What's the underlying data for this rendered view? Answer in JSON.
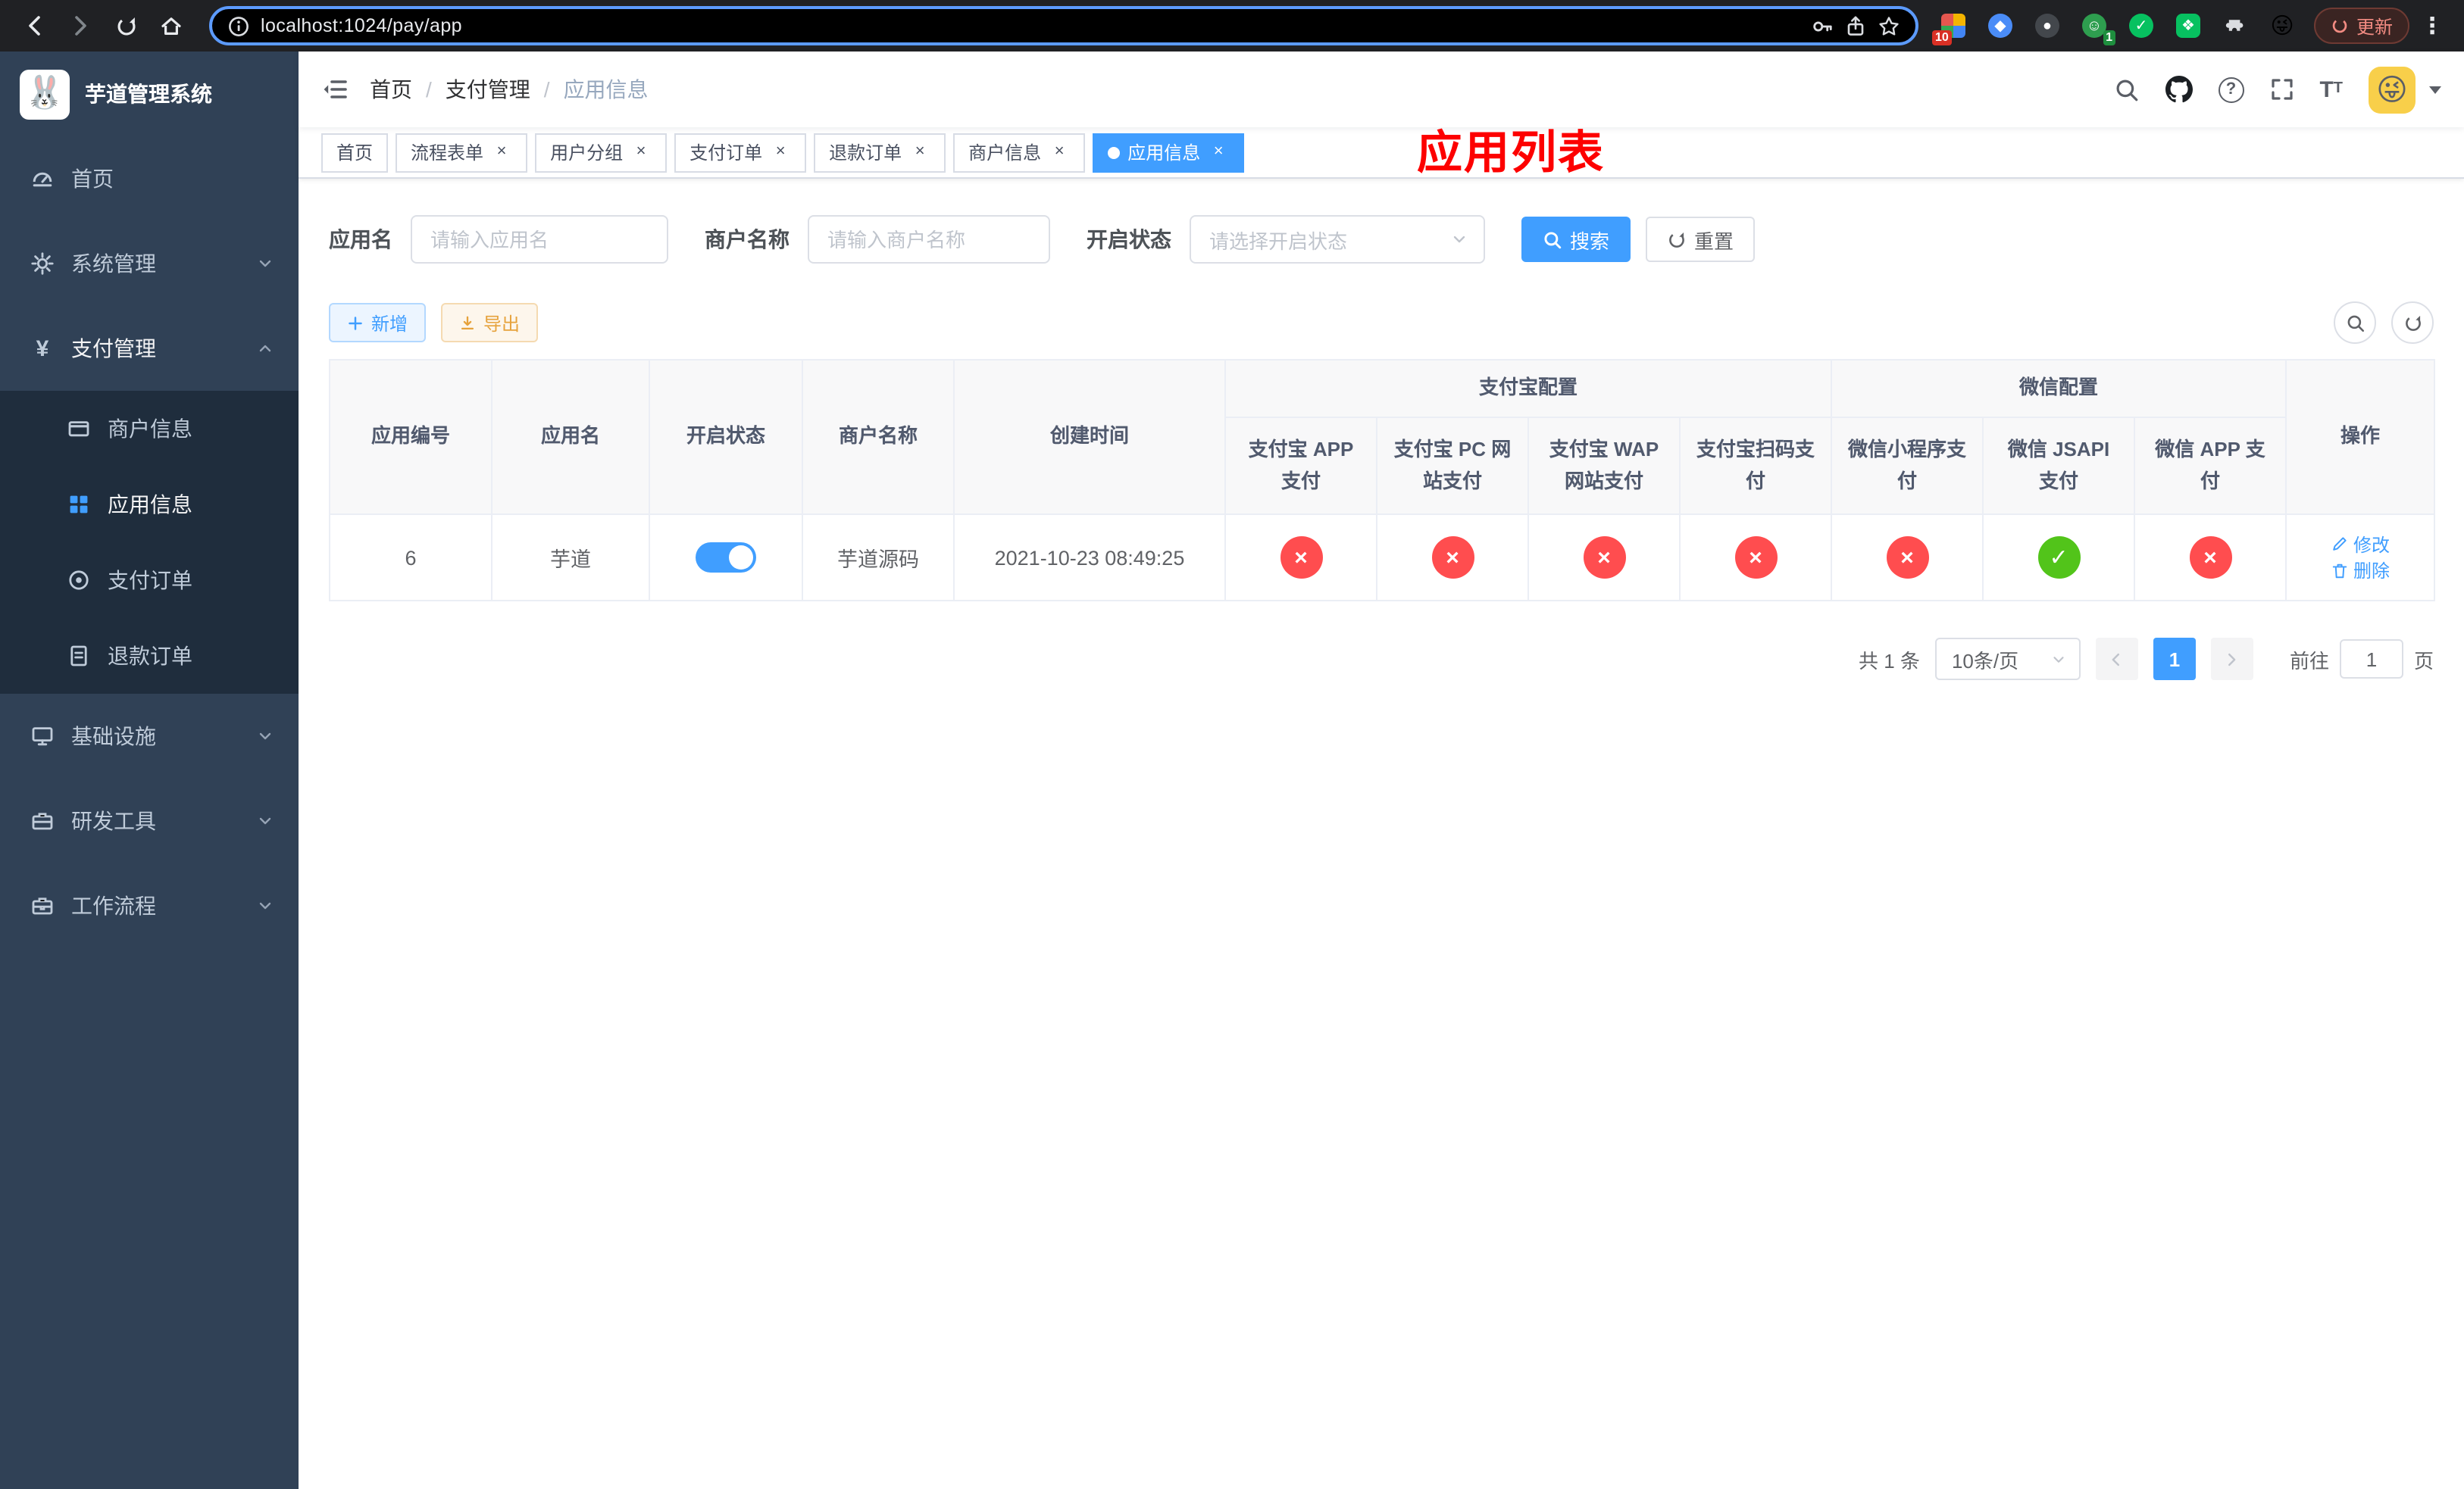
{
  "browser": {
    "url": "localhost:1024/pay/app",
    "update_label": "更新",
    "ext_badge_blocker": "10",
    "ext_badge_avatar": "1"
  },
  "icons": {
    "check": "✓",
    "cross": "×",
    "close": "×",
    "more": "⋮",
    "plus": "+"
  },
  "colors": {
    "primary": "#409eff",
    "danger": "#ff4d4f",
    "success": "#52c41a",
    "sidebar_bg": "#304156",
    "submenu_bg": "#1f2d3d",
    "annotation_red": "#fd0100"
  },
  "sidebar": {
    "title": "芋道管理系统",
    "logo_emoji": "🐰",
    "menu": [
      {
        "label": "首页"
      },
      {
        "label": "系统管理"
      },
      {
        "label": "支付管理"
      },
      {
        "label": "基础设施"
      },
      {
        "label": "研发工具"
      },
      {
        "label": "工作流程"
      }
    ],
    "submenu": [
      {
        "label": "商户信息"
      },
      {
        "label": "应用信息"
      },
      {
        "label": "支付订单"
      },
      {
        "label": "退款订单"
      }
    ]
  },
  "navbar": {
    "breadcrumb": [
      {
        "label": "首页"
      },
      {
        "label": "支付管理"
      },
      {
        "label": "应用信息"
      }
    ],
    "annotation": "应用列表",
    "avatar_emoji": "😜"
  },
  "tabs": [
    {
      "label": "首页"
    },
    {
      "label": "流程表单"
    },
    {
      "label": "用户分组"
    },
    {
      "label": "支付订单"
    },
    {
      "label": "退款订单"
    },
    {
      "label": "商户信息"
    },
    {
      "label": "应用信息"
    }
  ],
  "filter": {
    "app_name": {
      "label": "应用名",
      "placeholder": "请输入应用名",
      "value": ""
    },
    "merchant_name": {
      "label": "商户名称",
      "placeholder": "请输入商户名称",
      "value": ""
    },
    "status": {
      "label": "开启状态",
      "placeholder": "请选择开启状态",
      "value": ""
    },
    "search": "搜索",
    "reset": "重置"
  },
  "toolbar": {
    "add": "新增",
    "export": "导出"
  },
  "table": {
    "columns": {
      "id": "应用编号",
      "name": "应用名",
      "status": "开启状态",
      "merchant": "商户名称",
      "created": "创建时间",
      "alipay_group": "支付宝配置",
      "alipay": [
        "支付宝 APP 支付",
        "支付宝 PC 网站支付",
        "支付宝 WAP 网站支付",
        "支付宝扫码支付"
      ],
      "wechat_group": "微信配置",
      "wechat": [
        "微信小程序支付",
        "微信 JSAPI 支付",
        "微信 APP 支付"
      ],
      "actions": "操作"
    },
    "rows": [
      {
        "id": "6",
        "name": "芋道",
        "enabled": true,
        "merchant": "芋道源码",
        "created": "2021-10-23 08:49:25",
        "alipay": [
          false,
          false,
          false,
          false
        ],
        "wechat": [
          false,
          true,
          false
        ],
        "edit": "修改",
        "delete": "删除"
      }
    ]
  },
  "pagination": {
    "total": "共 1 条",
    "page_size": "10条/页",
    "page": "1",
    "goto": "前往",
    "goto_value": "1",
    "unit": "页"
  }
}
